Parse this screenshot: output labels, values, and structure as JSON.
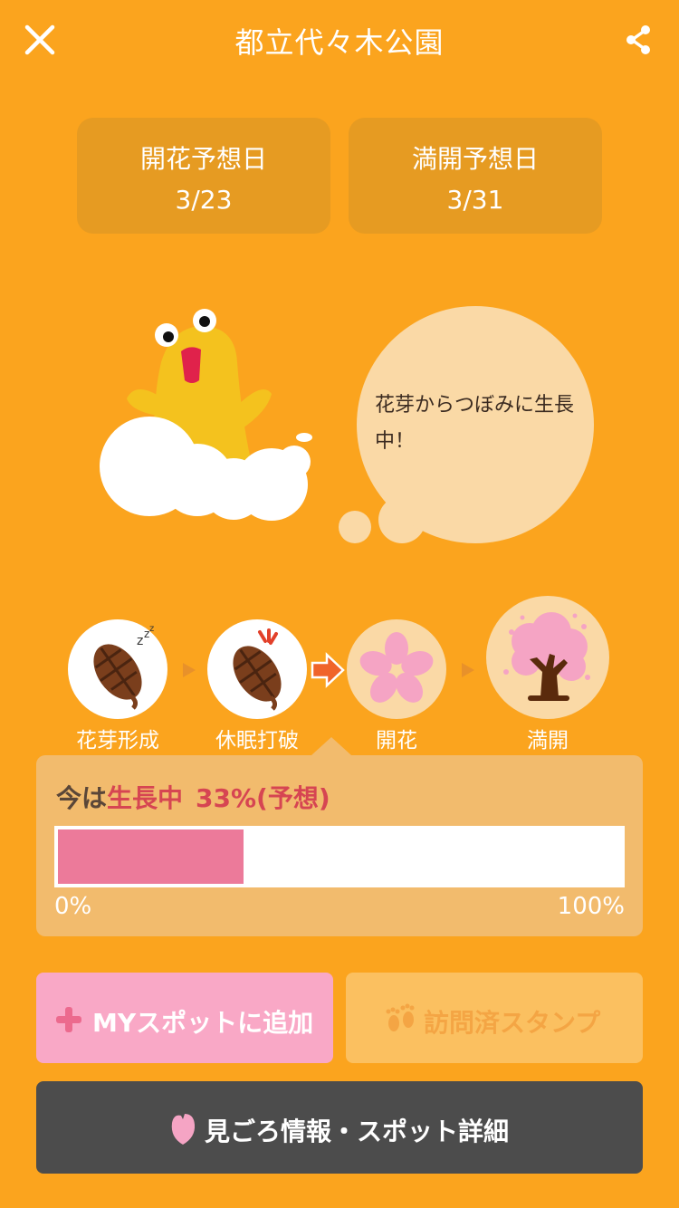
{
  "header": {
    "title": "都立代々木公園"
  },
  "forecast": {
    "bloom": {
      "label": "開花予想日",
      "date": "3/23"
    },
    "full": {
      "label": "満開予想日",
      "date": "3/31"
    }
  },
  "bubble": {
    "message": "花芽からつぼみに生長中！"
  },
  "stages": [
    {
      "label": "花芽形成",
      "icon": "sleeping-bud-icon"
    },
    {
      "label": "休眠打破",
      "icon": "awakening-bud-icon"
    },
    {
      "label": "開花",
      "icon": "sakura-flower-icon"
    },
    {
      "label": "満開",
      "icon": "blooming-tree-icon"
    }
  ],
  "progress": {
    "prefix": "今は",
    "stage": "生長中",
    "percent_text": "33%(予想)",
    "fraction": 0.33,
    "min_label": "0%",
    "max_label": "100%"
  },
  "buttons": {
    "my_spot": "MYスポットに追加",
    "visited_stamp": "訪問済スタンプ",
    "details": "見ごろ情報・スポット詳細"
  },
  "colors": {
    "background": "#FBA41E",
    "accent_pink": "#EC7A9A",
    "status_red": "#D64552",
    "dark_button": "#4C4C4C"
  }
}
